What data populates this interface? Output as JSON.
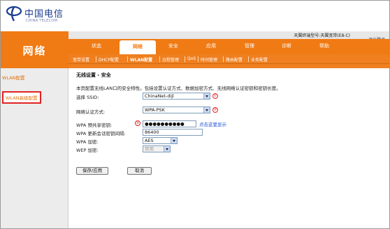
{
  "brand": {
    "name_cn": "中国电信",
    "name_en": "CHINA TELECOM"
  },
  "header": {
    "device_info": "天翼终端型号:天翼宽带(E8-C)",
    "logout": "退出登录"
  },
  "side_title": "网络",
  "tabs": [
    {
      "label": "状态"
    },
    {
      "label": "网络"
    },
    {
      "label": "安全"
    },
    {
      "label": "应用"
    },
    {
      "label": "管理"
    },
    {
      "label": "诊断"
    },
    {
      "label": "帮助"
    }
  ],
  "subnav": [
    {
      "label": "宽带设置"
    },
    {
      "label": "DHCP配置"
    },
    {
      "label": "WLAN配置"
    },
    {
      "label": "远程管理"
    },
    {
      "label": "QoS"
    },
    {
      "label": "时间管理"
    },
    {
      "label": "路由配置"
    },
    {
      "label": "业务配置"
    }
  ],
  "leftmenu": [
    {
      "label": "WLAN配置"
    },
    {
      "label": "WLAN高级配置"
    }
  ],
  "content": {
    "title": "无线设置 - 安全",
    "description": "本页配置无线LAN口的安全特性。包括设置认证方式、数据加密方式、无线网络认证密钥和密钥长度。",
    "ssid_label": "选择 SSID:",
    "ssid_value": "ChinaNet-dijl",
    "auth_label": "网络认证方式:",
    "auth_value": "WPA-PSK",
    "psk_label": "WPA 预共享密钥:",
    "psk_value": "●●●●●●●●●●",
    "show_link": "点击这里显示",
    "rekey_label": "WPA 更新会话密钥间隔:",
    "rekey_value": "86400",
    "enc_label": "WPA 加密:",
    "enc_value": "AES",
    "wep_label": "WEP 加密:",
    "wep_value": "禁用",
    "markers": [
      "①",
      "②",
      "③"
    ],
    "save_button": "保存/应用",
    "cancel_button": "取消"
  },
  "colors": {
    "accent": "#f07a13",
    "brand_blue": "#1a3d8f",
    "marker_red": "#e02222",
    "link_blue": "#1a4fd1"
  }
}
